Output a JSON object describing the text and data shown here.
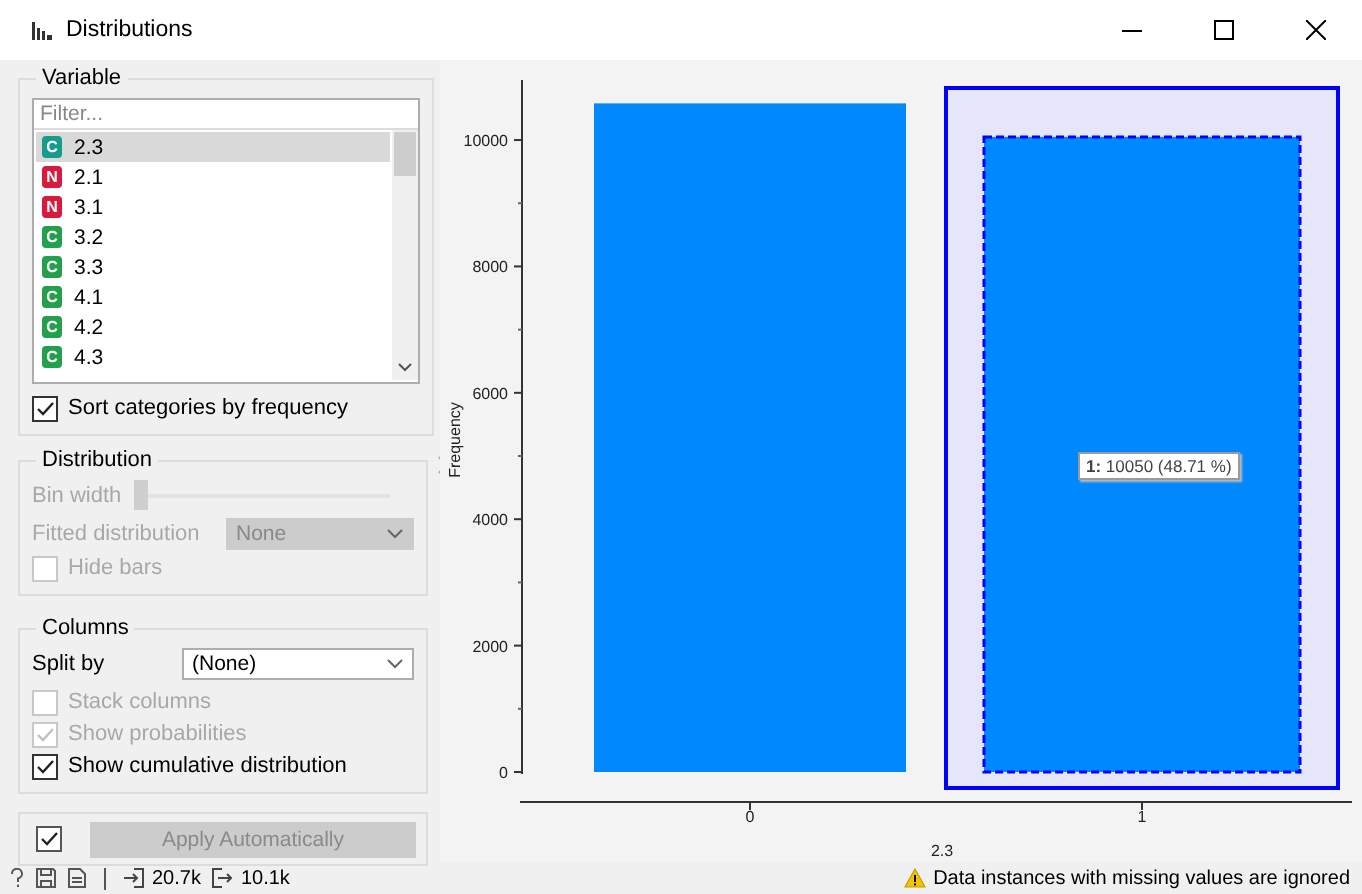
{
  "window": {
    "title": "Distributions"
  },
  "variable": {
    "title": "Variable",
    "filter_placeholder": "Filter...",
    "items": [
      {
        "badge": "C",
        "name": "2.3",
        "color": "#179c8c",
        "selected": true
      },
      {
        "badge": "N",
        "name": "2.1",
        "color": "#d81b3c",
        "selected": false
      },
      {
        "badge": "N",
        "name": "3.1",
        "color": "#d81b3c",
        "selected": false
      },
      {
        "badge": "C",
        "name": "3.2",
        "color": "#22a04b",
        "selected": false
      },
      {
        "badge": "C",
        "name": "3.3",
        "color": "#22a04b",
        "selected": false
      },
      {
        "badge": "C",
        "name": "4.1",
        "color": "#22a04b",
        "selected": false
      },
      {
        "badge": "C",
        "name": "4.2",
        "color": "#22a04b",
        "selected": false
      },
      {
        "badge": "C",
        "name": "4.3",
        "color": "#22a04b",
        "selected": false
      }
    ],
    "sort_checkbox": {
      "label": "Sort categories by frequency",
      "checked": true
    }
  },
  "distribution": {
    "title": "Distribution",
    "bin_width": {
      "label": "Bin width",
      "level": 0,
      "disabled": true
    },
    "fitted": {
      "label": "Fitted distribution",
      "value": "None",
      "disabled": true
    },
    "hide_bars": {
      "label": "Hide bars",
      "checked": false,
      "disabled": true
    }
  },
  "columns": {
    "title": "Columns",
    "split_by": {
      "label": "Split by",
      "value": "(None)"
    },
    "options": [
      {
        "label": "Stack columns",
        "checked": false,
        "disabled": true
      },
      {
        "label": "Show probabilities",
        "checked": true,
        "disabled": true
      },
      {
        "label": "Show cumulative distribution",
        "checked": true,
        "disabled": false
      }
    ]
  },
  "apply": {
    "auto_checked": true,
    "button": "Apply Automatically",
    "disabled": true
  },
  "chart": {
    "chart_data": {
      "type": "bar",
      "xlabel": "2.3",
      "ylabel": "Frequency",
      "categories": [
        "0",
        "1"
      ],
      "values": [
        10580,
        10050
      ],
      "ylim": [
        0,
        10950
      ],
      "yticks": [
        0,
        2000,
        4000,
        6000,
        8000,
        10000
      ]
    },
    "selected": [
      false,
      true
    ],
    "tooltip": "**1:** 10050 (48.71 %)"
  },
  "status_bar": {
    "input_count": "20.7k",
    "output_count": "10.1k",
    "warning": "Data instances with missing values are ignored"
  }
}
